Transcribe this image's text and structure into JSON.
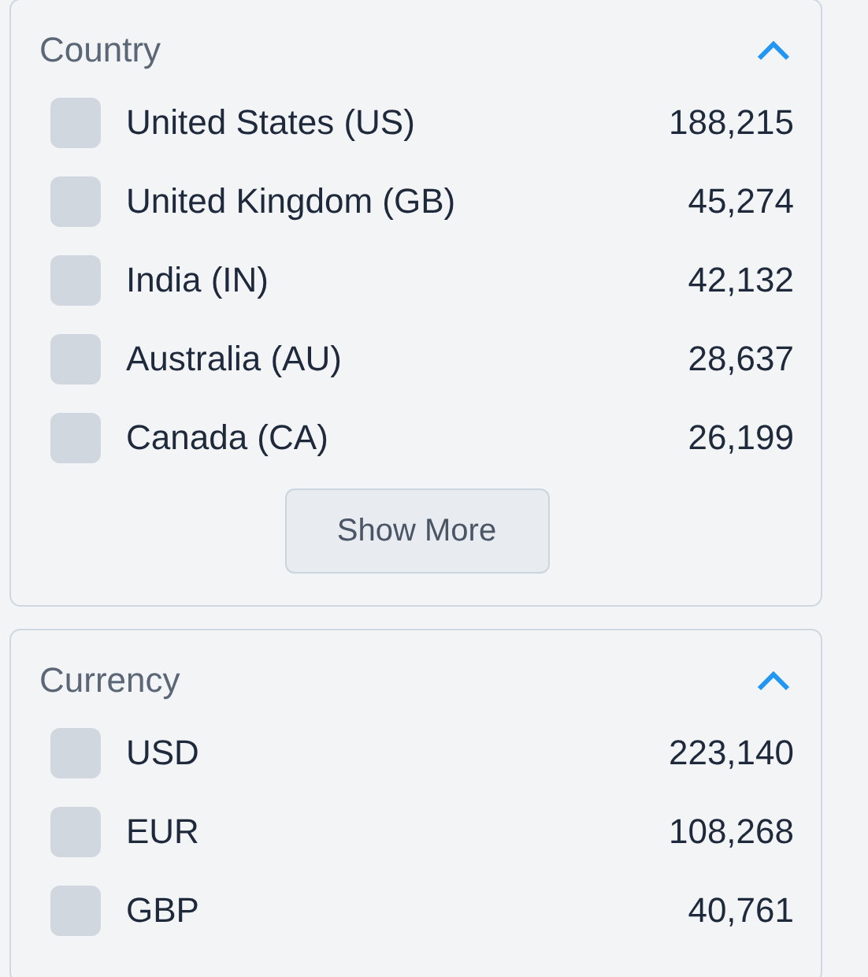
{
  "filters": [
    {
      "title": "Country",
      "expanded": true,
      "options": [
        {
          "label": "United States (US)",
          "count": "188,215",
          "checked": false
        },
        {
          "label": "United Kingdom (GB)",
          "count": "45,274",
          "checked": false
        },
        {
          "label": "India (IN)",
          "count": "42,132",
          "checked": false
        },
        {
          "label": "Australia (AU)",
          "count": "28,637",
          "checked": false
        },
        {
          "label": "Canada (CA)",
          "count": "26,199",
          "checked": false
        }
      ],
      "show_more": "Show More"
    },
    {
      "title": "Currency",
      "expanded": true,
      "options": [
        {
          "label": "USD",
          "count": "223,140",
          "checked": false
        },
        {
          "label": "EUR",
          "count": "108,268",
          "checked": false
        },
        {
          "label": "GBP",
          "count": "40,761",
          "checked": false
        }
      ]
    }
  ]
}
